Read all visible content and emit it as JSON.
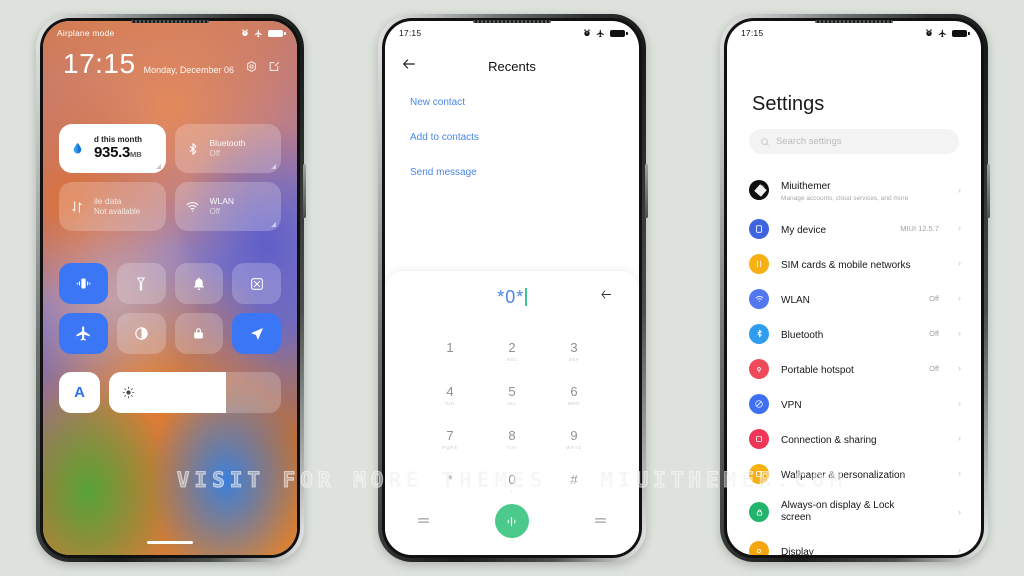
{
  "background_color": "#dde3dc",
  "watermark": "VISIT FOR MORE THEMES - MIUITHEMER.COM",
  "phone1": {
    "status": {
      "label": "Airplane mode",
      "icons": [
        "alarm-icon",
        "airplane-icon",
        "battery-icon"
      ]
    },
    "clock": {
      "time": "17:15",
      "date": "Monday, December 06"
    },
    "header_icons": [
      "settings-gear-icon",
      "edit-icon"
    ],
    "cards": [
      {
        "title": "d this month",
        "value": "935.3",
        "unit": "MB",
        "icon": "data-drop-icon",
        "active": true
      },
      {
        "title": "Bluetooth",
        "subtitle": "Off",
        "icon": "bluetooth-icon",
        "active": false
      },
      {
        "title": "ile data",
        "subtitle": "Not available",
        "icon": "mobile-data-icon",
        "active": false,
        "dim": true
      },
      {
        "title": "WLAN",
        "subtitle": "Off",
        "icon": "wifi-icon",
        "active": false
      }
    ],
    "toggles": [
      {
        "icon": "vibrate-icon",
        "on": true
      },
      {
        "icon": "flashlight-icon",
        "on": false
      },
      {
        "icon": "bell-icon",
        "on": false
      },
      {
        "icon": "screenshot-icon",
        "on": false
      },
      {
        "icon": "airplane-icon",
        "on": true
      },
      {
        "icon": "dark-mode-icon",
        "on": false
      },
      {
        "icon": "lock-icon",
        "on": false
      },
      {
        "icon": "location-icon",
        "on": true
      }
    ],
    "auto_brightness_label": "A",
    "brightness_percent": 68,
    "brightness_icon": "sun-icon"
  },
  "phone2": {
    "status": {
      "time": "17:15",
      "icons": [
        "alarm-icon",
        "airplane-icon",
        "battery-icon"
      ]
    },
    "header": {
      "back_icon": "arrow-left-icon",
      "title": "Recents"
    },
    "links": [
      "New contact",
      "Add to contacts",
      "Send message"
    ],
    "dialer": {
      "entered_number": "*0*",
      "delete_icon": "backspace-arrow-icon",
      "keys": [
        {
          "digit": "1",
          "letters": ""
        },
        {
          "digit": "2",
          "letters": "ABC"
        },
        {
          "digit": "3",
          "letters": "DEF"
        },
        {
          "digit": "4",
          "letters": "GHI"
        },
        {
          "digit": "5",
          "letters": "JKL"
        },
        {
          "digit": "6",
          "letters": "MNO"
        },
        {
          "digit": "7",
          "letters": "PQRS"
        },
        {
          "digit": "8",
          "letters": "TUV"
        },
        {
          "digit": "9",
          "letters": "WXYZ"
        },
        {
          "digit": "*",
          "letters": ""
        },
        {
          "digit": "0",
          "letters": "+"
        },
        {
          "digit": "#",
          "letters": ""
        }
      ],
      "call_button_icon": "call-icon",
      "call_button_color": "#4bca8c",
      "left_icon": "menu-icon",
      "right_icon": "menu-icon"
    }
  },
  "phone3": {
    "status": {
      "time": "17:15",
      "icons": [
        "alarm-icon",
        "airplane-icon",
        "battery-icon"
      ]
    },
    "title": "Settings",
    "search": {
      "placeholder": "Search settings",
      "icon": "search-icon"
    },
    "items": [
      {
        "label": "Miuithemer",
        "sub": "Manage accounts, cloud services, and more",
        "value": "",
        "icon": "account-avatar",
        "color": "#111111"
      },
      {
        "label": "My device",
        "sub": "",
        "value": "MIUI 12.5.7",
        "icon": "device-icon",
        "color": "#4063e0"
      },
      {
        "label": "SIM cards & mobile networks",
        "sub": "",
        "value": "",
        "icon": "sim-icon",
        "color": "#f7b012"
      },
      {
        "label": "WLAN",
        "sub": "",
        "value": "Off",
        "icon": "wifi-icon",
        "color": "#5277ee"
      },
      {
        "label": "Bluetooth",
        "sub": "",
        "value": "Off",
        "icon": "bluetooth-icon",
        "color": "#2f9ced"
      },
      {
        "label": "Portable hotspot",
        "sub": "",
        "value": "Off",
        "icon": "hotspot-icon",
        "color": "#ef4a5c"
      },
      {
        "label": "VPN",
        "sub": "",
        "value": "",
        "icon": "vpn-icon",
        "color": "#3d6ff0"
      },
      {
        "label": "Connection & sharing",
        "sub": "",
        "value": "",
        "icon": "share-icon",
        "color": "#ef3657"
      },
      {
        "label": "Wallpaper & personalization",
        "sub": "",
        "value": "",
        "icon": "wallpaper-icon",
        "color": "#f5b013"
      },
      {
        "label": "Always-on display & Lock screen",
        "sub": "",
        "value": "",
        "icon": "aod-icon",
        "color": "#22b46b"
      },
      {
        "label": "Display",
        "sub": "",
        "value": "",
        "icon": "display-icon",
        "color": "#f5a60f"
      }
    ],
    "chevron": "›"
  }
}
